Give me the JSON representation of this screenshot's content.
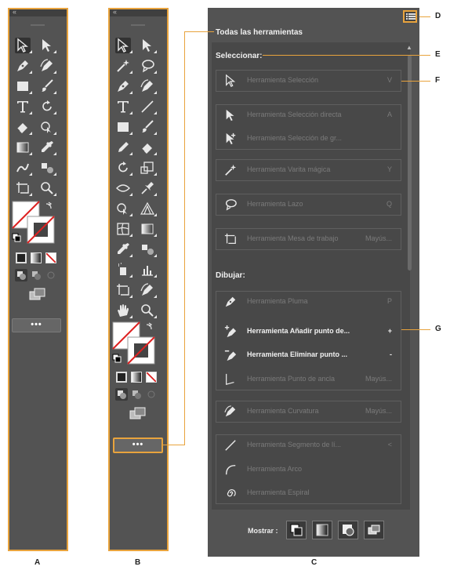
{
  "toolbar_header_chevron": "‹‹",
  "more_button_label": "•••",
  "panel": {
    "title": "Todas las herramientas",
    "menu_icon": "list-menu-icon",
    "sections": [
      {
        "title": "Seleccionar:",
        "tools": [
          {
            "name": "Herramienta Selección",
            "shortcut": "V",
            "icon": "selection-arrow-icon",
            "active": false
          },
          {
            "name": "Herramienta Selección directa",
            "shortcut": "A",
            "icon": "direct-selection-icon",
            "active": false
          },
          {
            "name": "Herramienta Selección de gr...",
            "shortcut": "",
            "icon": "group-selection-icon",
            "active": false
          },
          {
            "name": "Herramienta Varita mágica",
            "shortcut": "Y",
            "icon": "magic-wand-icon",
            "active": false
          },
          {
            "name": "Herramienta Lazo",
            "shortcut": "Q",
            "icon": "lasso-icon",
            "active": false
          },
          {
            "name": "Herramienta Mesa de trabajo",
            "shortcut": "Mayús...",
            "icon": "artboard-icon",
            "active": false
          }
        ]
      },
      {
        "title": "Dibujar:",
        "tools": [
          {
            "name": "Herramienta Pluma",
            "shortcut": "P",
            "icon": "pen-icon",
            "active": false
          },
          {
            "name": "Herramienta Añadir punto de...",
            "shortcut": "+",
            "icon": "add-anchor-icon",
            "active": true
          },
          {
            "name": "Herramienta Eliminar punto ...",
            "shortcut": "-",
            "icon": "delete-anchor-icon",
            "active": true
          },
          {
            "name": "Herramienta Punto de ancla",
            "shortcut": "Mayús...",
            "icon": "anchor-point-icon",
            "active": false
          },
          {
            "name": "Herramienta Curvatura",
            "shortcut": "Mayús...",
            "icon": "curvature-icon",
            "active": false
          },
          {
            "name": "Herramienta Segmento de lí...",
            "shortcut": "<",
            "icon": "line-segment-icon",
            "active": false
          },
          {
            "name": "Herramienta Arco",
            "shortcut": "",
            "icon": "arc-icon",
            "active": false
          },
          {
            "name": "Herramienta Espiral",
            "shortcut": "",
            "icon": "spiral-icon",
            "active": false
          }
        ]
      }
    ],
    "mostrar_label": "Mostrar :"
  },
  "callouts": [
    "D",
    "E",
    "F",
    "G"
  ],
  "bottom_labels": [
    "A",
    "B",
    "C"
  ],
  "colors": {
    "accent": "#e8a33d",
    "panel_bg": "#535353",
    "dark": "#3f3f3f"
  }
}
